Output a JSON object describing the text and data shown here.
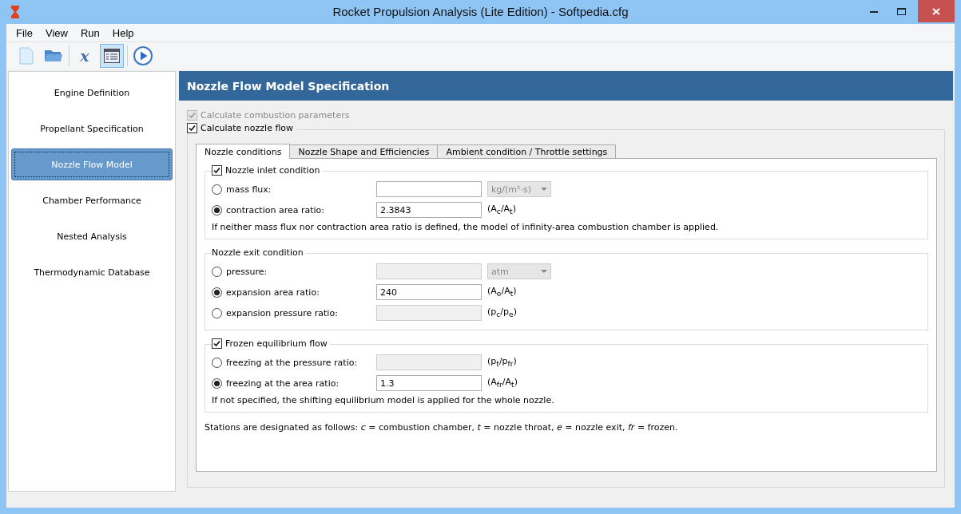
{
  "window": {
    "title": "Rocket Propulsion Analysis (Lite Edition) - Softpedia.cfg"
  },
  "menu": [
    "File",
    "View",
    "Run",
    "Help"
  ],
  "toolbar": [
    {
      "kind": "new",
      "selected": false
    },
    {
      "kind": "open",
      "selected": false
    },
    {
      "kind": "letter",
      "label": "x",
      "selected": false
    },
    {
      "kind": "list",
      "selected": true
    },
    {
      "kind": "run",
      "selected": false
    }
  ],
  "sidebar": {
    "items": [
      {
        "label": "Engine Definition",
        "selected": false
      },
      {
        "label": "Propellant Specification",
        "selected": false
      },
      {
        "label": "Nozzle Flow Model",
        "selected": true
      },
      {
        "label": "Chamber Performance",
        "selected": false
      },
      {
        "label": "Nested Analysis",
        "selected": false
      },
      {
        "label": "Thermodynamic Database",
        "selected": false
      }
    ]
  },
  "panel": {
    "title": "Nozzle Flow Model Specification",
    "options": [
      {
        "label": "Calculate combustion parameters",
        "checked": true,
        "disabled": true
      },
      {
        "label": "Calculate nozzle flow",
        "checked": true,
        "disabled": false
      }
    ],
    "tabs": [
      {
        "label": "Nozzle conditions",
        "selected": true
      },
      {
        "label": "Nozzle Shape and Efficiencies",
        "selected": false
      },
      {
        "label": "Ambient condition / Throttle settings",
        "selected": false
      }
    ],
    "groups": [
      {
        "kind": "checkbox",
        "title": "Nozzle inlet condition",
        "checked": true,
        "rows": [
          {
            "label": "mass flux:",
            "selected": false,
            "disabled": false,
            "unit_select": "kg/(m²·s)"
          },
          {
            "label": "contraction area ratio:",
            "selected": true,
            "disabled": false,
            "value": "2.3843",
            "unit": "(A$_{c}$/A$_{t}$)"
          }
        ],
        "note": "If neither mass flux nor contraction area ratio is defined, the model of infinity-area combustion chamber is applied."
      },
      {
        "kind": "plain",
        "title": "Nozzle exit condition",
        "rows": [
          {
            "label": "pressure:",
            "selected": false,
            "disabled": true,
            "unit_select": "atm"
          },
          {
            "label": "expansion area ratio:",
            "selected": true,
            "disabled": false,
            "value": "240",
            "unit": "(A$_{e}$/A$_{t}$)"
          },
          {
            "label": "expansion pressure ratio:",
            "selected": false,
            "disabled": true,
            "unit": "(p$_{c}$/p$_{e}$)"
          }
        ]
      },
      {
        "kind": "checkbox",
        "title": "Frozen equilibrium flow",
        "checked": true,
        "rows": [
          {
            "label": "freezing at the pressure ratio:",
            "selected": false,
            "disabled": true,
            "unit": "(p$_{t}$/p$_{fr}$)"
          },
          {
            "label": "freezing at the area ratio:",
            "selected": true,
            "disabled": false,
            "value": "1.3",
            "unit": "(A$_{fr}$/A$_{t}$)"
          }
        ],
        "note": "If not specified, the shifting equilibrium model is applied for the whole nozzle."
      }
    ],
    "footnote": "Stations are designated as follows: *c* = combustion chamber, *t* = nozzle throat, *e* = nozzle exit, *fr* = frozen."
  }
}
